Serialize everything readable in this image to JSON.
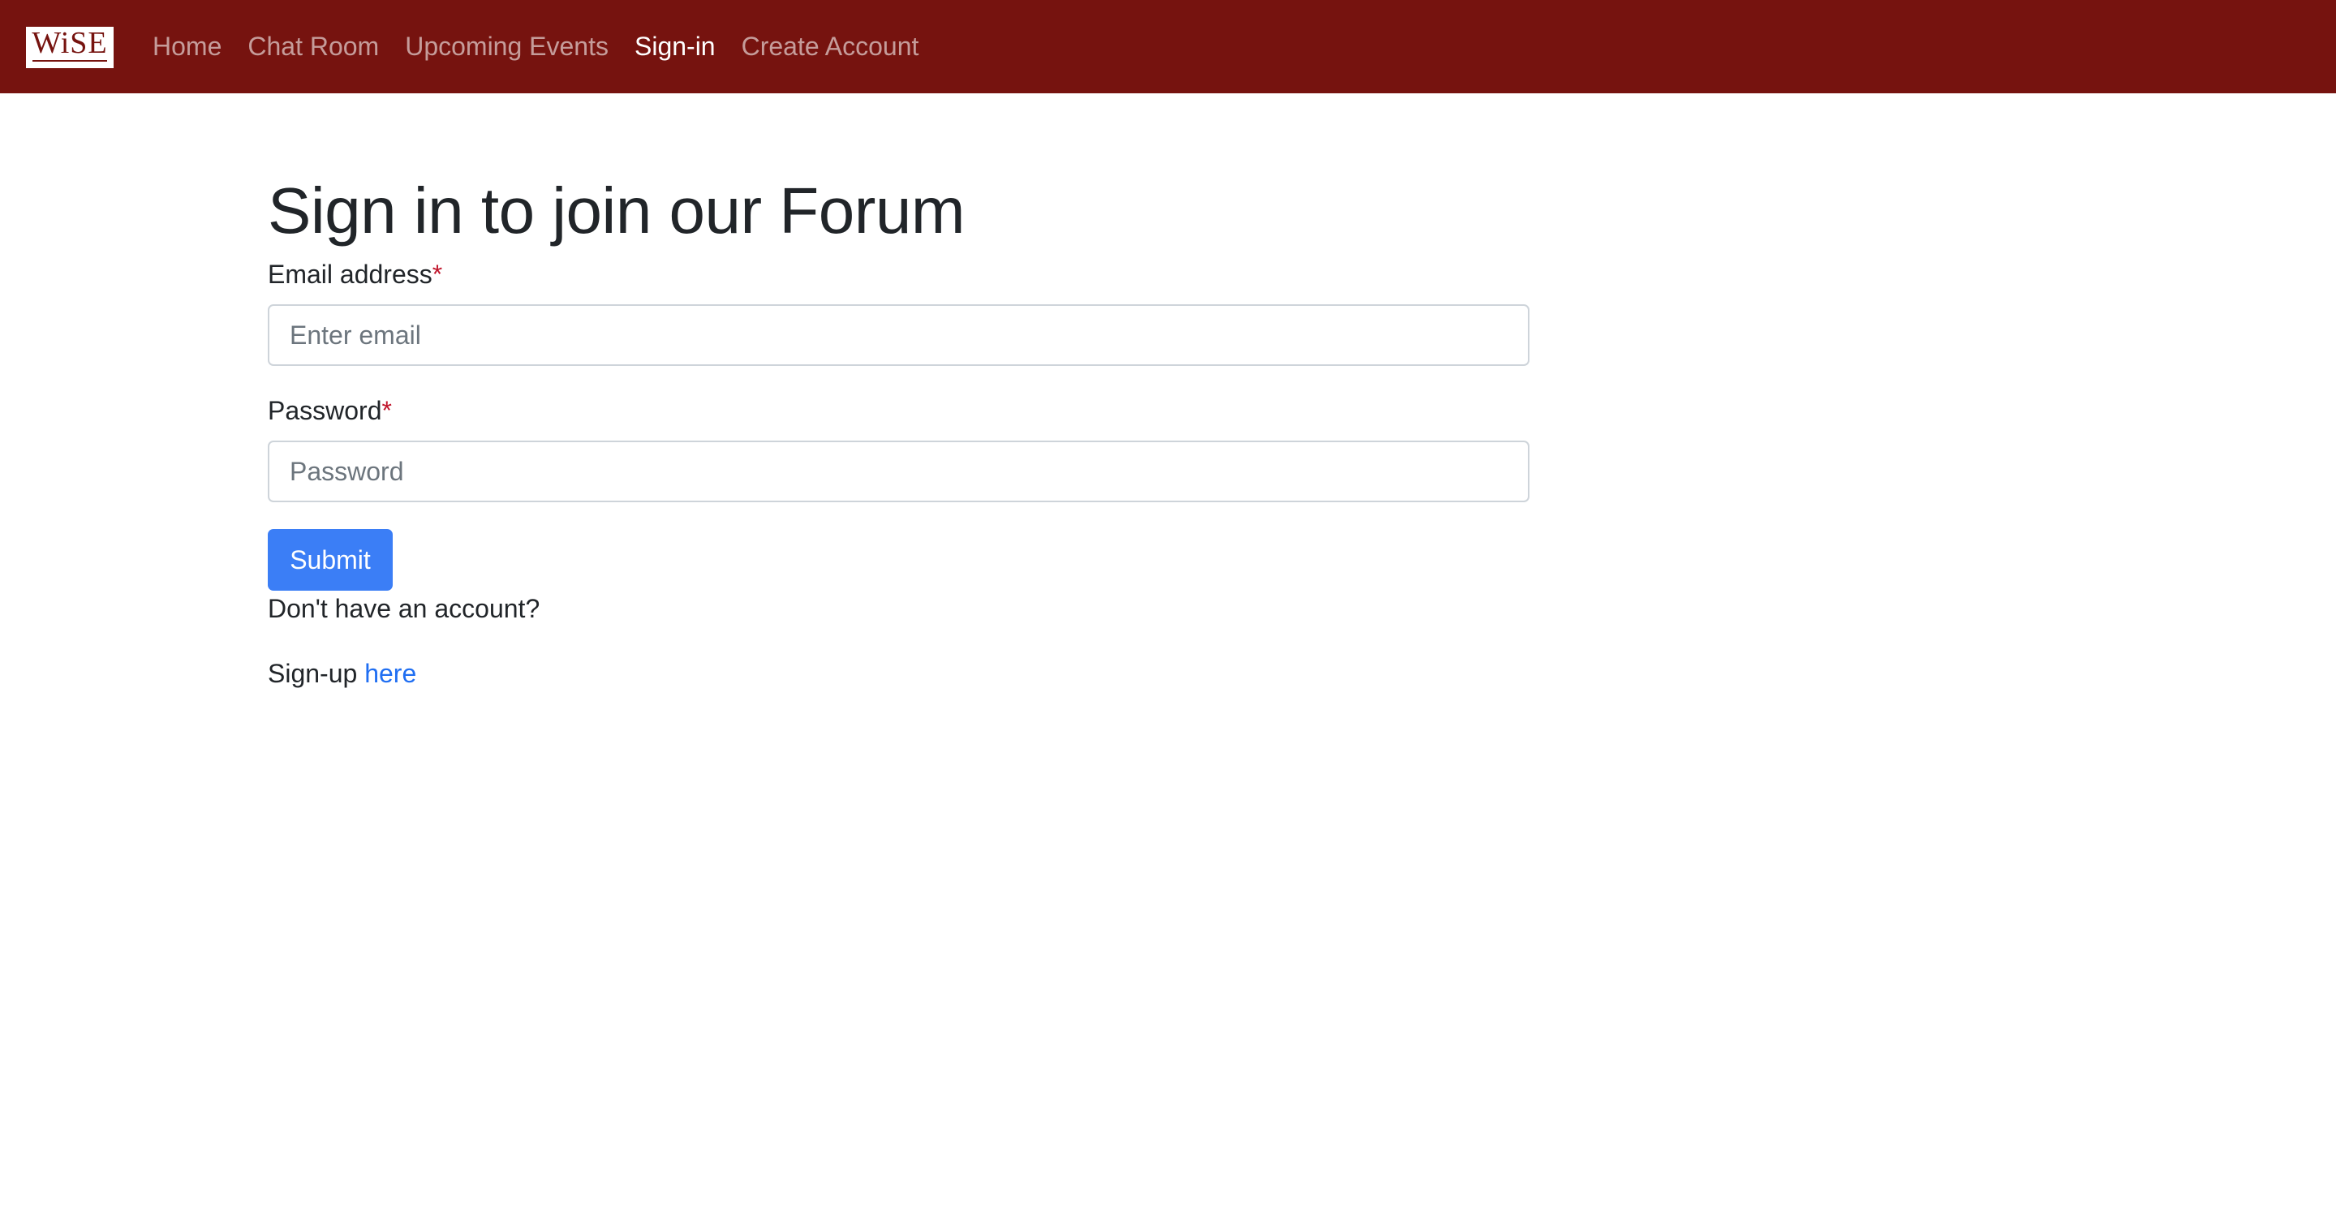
{
  "navbar": {
    "logo_text": "WiSE",
    "background_color": "#76130f",
    "items": [
      {
        "label": "Home",
        "active": false
      },
      {
        "label": "Chat Room",
        "active": false
      },
      {
        "label": "Upcoming Events",
        "active": false
      },
      {
        "label": "Sign-in",
        "active": true
      },
      {
        "label": "Create Account",
        "active": false
      }
    ]
  },
  "main": {
    "title": "Sign in to join our Forum",
    "email": {
      "label": "Email address",
      "required_mark": "*",
      "placeholder": "Enter email",
      "value": ""
    },
    "password": {
      "label": "Password",
      "required_mark": "*",
      "placeholder": "Password",
      "value": ""
    },
    "submit_label": "Submit",
    "no_account_text": "Don't have an account?",
    "signup_prefix": "Sign-up",
    "signup_link_label": "here"
  },
  "colors": {
    "accent": "#3b7ef6",
    "link": "#1f6ef2",
    "required": "#c0152b"
  }
}
